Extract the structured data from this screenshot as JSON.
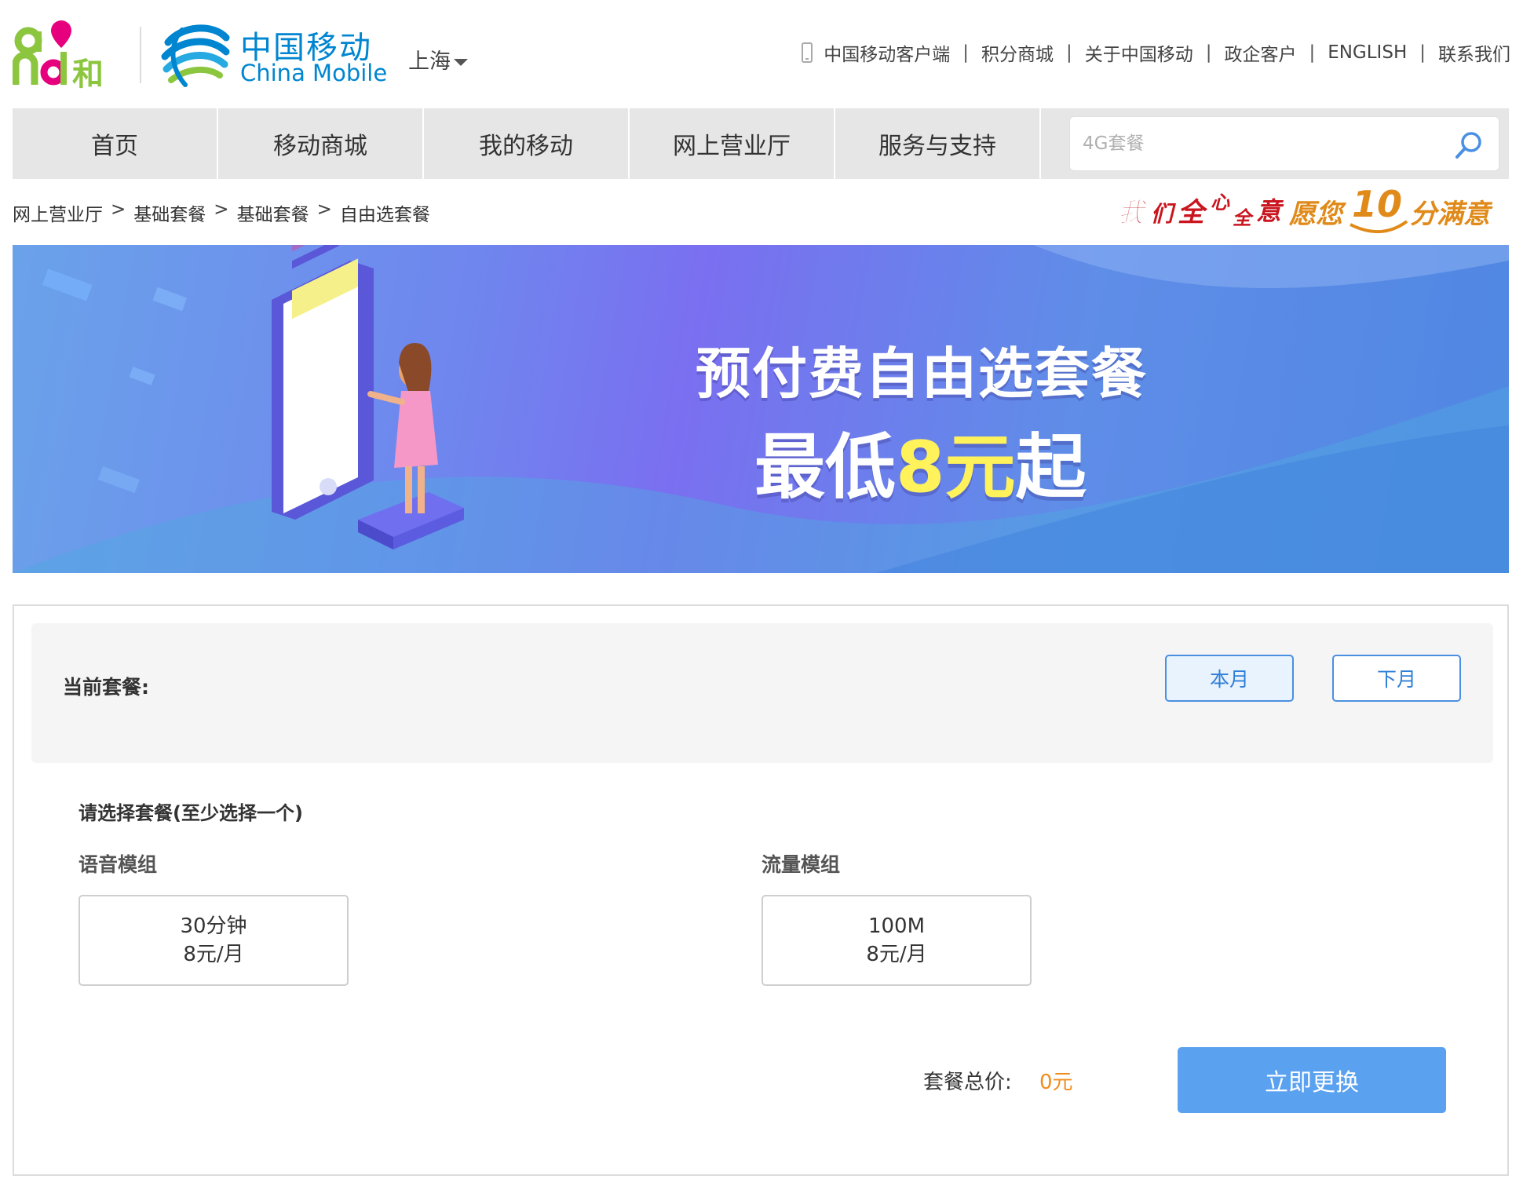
{
  "header": {
    "logo_and_text": "和",
    "logo_and_letters": "and",
    "brand_cn": "中国移动",
    "brand_en": "China Mobile",
    "city": "上海",
    "top_links": [
      "中国移动客户端",
      "积分商城",
      "关于中国移动",
      "政企客户",
      "ENGLISH",
      "联系我们"
    ],
    "separator": "|"
  },
  "nav": {
    "items": [
      "首页",
      "移动商城",
      "我的移动",
      "网上营业厅",
      "服务与支持"
    ],
    "search_placeholder": "4G套餐"
  },
  "breadcrumb": {
    "items": [
      "网上营业厅",
      "基础套餐",
      "基础套餐",
      "自由选套餐"
    ],
    "separator": ">"
  },
  "slogan": "我们全心全意 愿您10分满意",
  "banner": {
    "title": "预付费自由选套餐",
    "subtitle_prefix": "最低",
    "subtitle_highlight": "8元",
    "subtitle_suffix": "起"
  },
  "current_plan": {
    "label": "当前套餐:",
    "this_month": "本月",
    "next_month": "下月"
  },
  "selection": {
    "title": "请选择套餐(至少选择一个)",
    "voice_group": {
      "label": "语音模组",
      "options": [
        {
          "name": "30分钟",
          "price": "8元/月"
        }
      ]
    },
    "data_group": {
      "label": "流量模组",
      "options": [
        {
          "name": "100M",
          "price": "8元/月"
        }
      ]
    }
  },
  "footer": {
    "total_label": "套餐总价:",
    "total_value": "0元",
    "submit": "立即更换"
  },
  "colors": {
    "brand_blue": "#0085d0",
    "and_pink": "#e6007e",
    "and_green": "#8cc63f",
    "button_blue": "#5aa1ef",
    "price_orange": "#f08c1e"
  }
}
